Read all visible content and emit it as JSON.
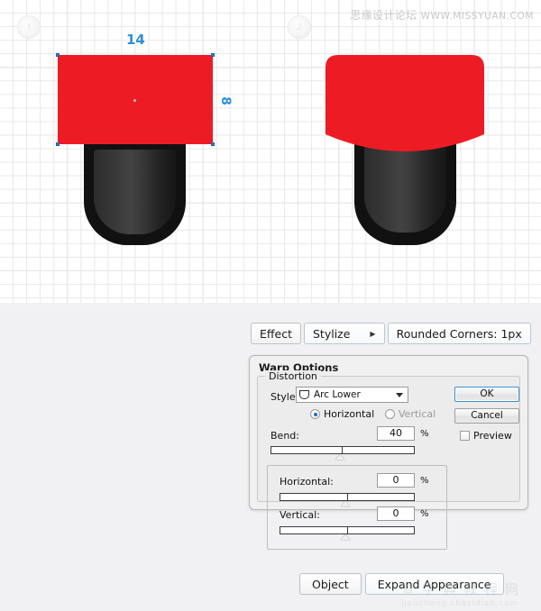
{
  "canvas": {
    "step_markers": [
      {
        "label": "1"
      },
      {
        "label": "2"
      }
    ],
    "measurements": {
      "width_label": "14",
      "height_label": "8"
    },
    "watermark": {
      "cn": "思缘设计论坛",
      "url": "WWW.MISSYUAN.COM"
    },
    "shapes": {
      "red_fill": "#ed1c24",
      "pill_outer_fill": "#111111",
      "pill_inner_fill": "#3a3a3a",
      "selection_color": "#2a7fd4"
    }
  },
  "breadcrumb": {
    "effect": "Effect",
    "stylize": "Stylize",
    "rounded_corners": "Rounded Corners: 1px"
  },
  "dialog": {
    "title": "Warp Options",
    "style": {
      "label": "Style:",
      "value": "Arc Lower"
    },
    "orientation": {
      "horizontal": "Horizontal",
      "vertical": "Vertical"
    },
    "bend": {
      "label": "Bend:",
      "value": "40",
      "unit": "%"
    },
    "distortion": {
      "legend": "Distortion",
      "horizontal": {
        "label": "Horizontal:",
        "value": "0",
        "unit": "%"
      },
      "vertical": {
        "label": "Vertical:",
        "value": "0",
        "unit": "%"
      }
    },
    "buttons": {
      "ok": "OK",
      "cancel": "Cancel",
      "preview": "Preview"
    }
  },
  "footer": {
    "object": "Object",
    "expand_appearance": "Expand Appearance",
    "watermark_cn": "查字典教程网",
    "watermark_url": "jiaocheng.chazidian.com"
  }
}
